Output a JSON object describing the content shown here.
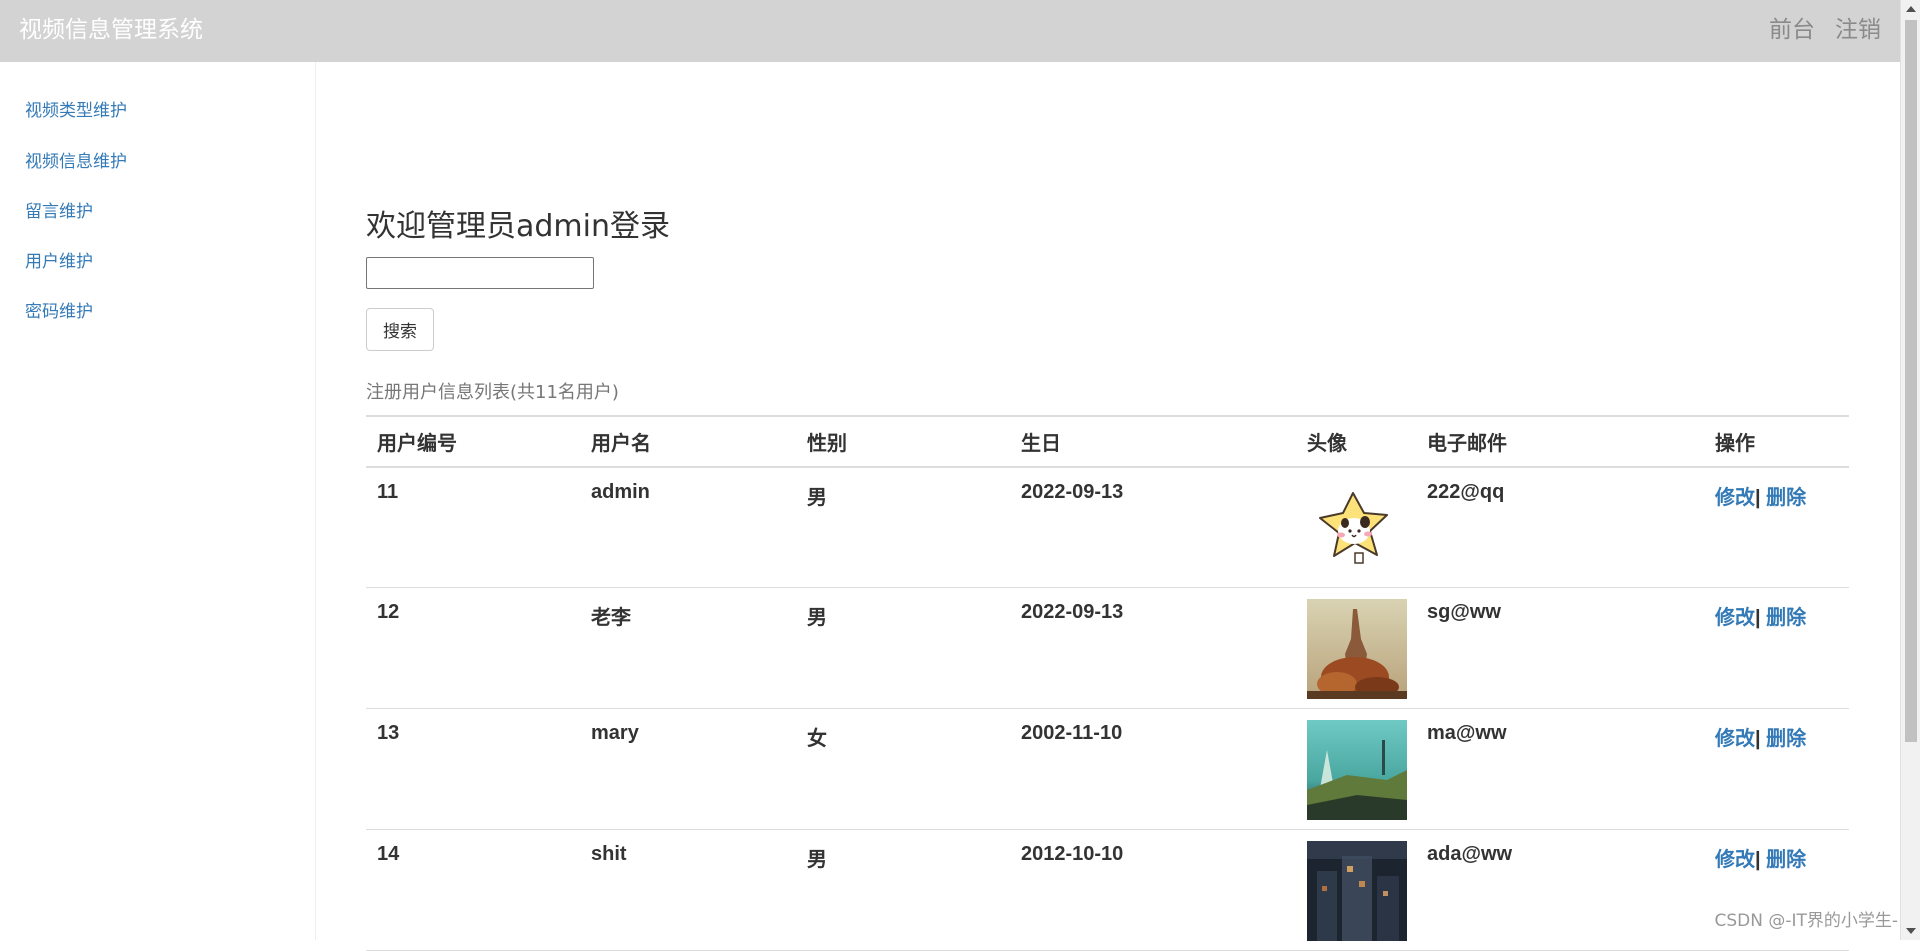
{
  "navbar": {
    "brand": "视频信息管理系统",
    "links": [
      "前台",
      "注销"
    ]
  },
  "sidebar": {
    "items": [
      {
        "label": "视频类型维护"
      },
      {
        "label": "视频信息维护"
      },
      {
        "label": "留言维护"
      },
      {
        "label": "用户维护"
      },
      {
        "label": "密码维护"
      }
    ]
  },
  "main": {
    "welcome": "欢迎管理员admin登录",
    "search": {
      "value": "",
      "placeholder": "",
      "button_label": "搜索"
    },
    "caption": "注册用户信息列表(共11名用户)"
  },
  "table": {
    "headers": [
      "用户编号",
      "用户名",
      "性别",
      "生日",
      "头像",
      "电子邮件",
      "操作"
    ],
    "rows": [
      {
        "id": "11",
        "name": "admin",
        "gender": "男",
        "birthday": "2022-09-13",
        "avatar": "star-cartoon-avatar",
        "email": "222@qq",
        "edit": "修改",
        "sep": "|",
        "delete": "删除"
      },
      {
        "id": "12",
        "name": "老李",
        "gender": "男",
        "birthday": "2022-09-13",
        "avatar": "castle-painting-avatar",
        "email": "sg@ww",
        "edit": "修改",
        "sep": "|",
        "delete": "删除"
      },
      {
        "id": "13",
        "name": "mary",
        "gender": "女",
        "birthday": "2002-11-10",
        "avatar": "teal-landscape-avatar",
        "email": "ma@ww",
        "edit": "修改",
        "sep": "|",
        "delete": "删除"
      },
      {
        "id": "14",
        "name": "shit",
        "gender": "男",
        "birthday": "2012-10-10",
        "avatar": "dark-city-avatar",
        "email": "ada@ww",
        "edit": "修改",
        "sep": "|",
        "delete": "删除"
      }
    ]
  },
  "watermark": "CSDN @-IT界的小学生-",
  "colors": {
    "navbar_bg": "#d3d3d3",
    "link": "#337ab7",
    "text": "#333333",
    "muted": "#777777"
  }
}
